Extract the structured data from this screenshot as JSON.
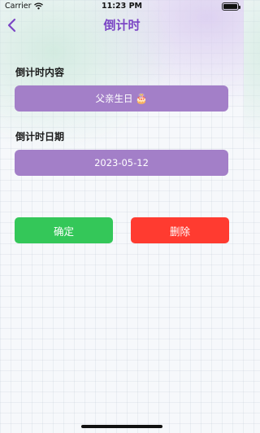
{
  "status_bar": {
    "carrier": "Carrier",
    "time": "11:23 PM",
    "wifi_icon": "wifi-icon",
    "battery_icon": "battery-icon",
    "battery_level": 1.0
  },
  "nav": {
    "title": "倒计时",
    "back_icon": "chevron-left-icon"
  },
  "form": {
    "content_label": "倒计时内容",
    "content_value": "父亲生日",
    "content_emoji": "🎂",
    "date_label": "倒计时日期",
    "date_value": "2023-05-12"
  },
  "actions": {
    "confirm_label": "确定",
    "delete_label": "删除"
  },
  "colors": {
    "accent": "#7b46c5",
    "field_bg": "#a37fc8",
    "confirm": "#34c759",
    "delete": "#ff3b30"
  }
}
